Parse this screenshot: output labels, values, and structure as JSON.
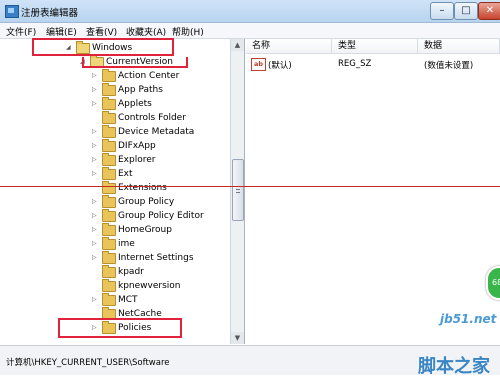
{
  "window": {
    "title": "注册表编辑器",
    "minimize": "–",
    "maximize": "□",
    "close": "✕"
  },
  "menu": [
    "文件(F)",
    "编辑(E)",
    "查看(V)",
    "收藏夹(A)",
    "帮助(H)"
  ],
  "tree": {
    "items": [
      {
        "label": "Windows",
        "expander": "◢"
      },
      {
        "label": "CurrentVersion",
        "expander": "◢"
      },
      {
        "label": "Action Center",
        "expander": "▷"
      },
      {
        "label": "App Paths",
        "expander": "▷"
      },
      {
        "label": "Applets",
        "expander": "▷"
      },
      {
        "label": "Controls Folder",
        "expander": ""
      },
      {
        "label": "Device Metadata",
        "expander": "▷"
      },
      {
        "label": "DIFxApp",
        "expander": "▷"
      },
      {
        "label": "Explorer",
        "expander": "▷"
      },
      {
        "label": "Ext",
        "expander": "▷"
      },
      {
        "label": "Extensions",
        "expander": ""
      },
      {
        "label": "Group Policy",
        "expander": "▷"
      },
      {
        "label": "Group Policy Editor",
        "expander": "▷"
      },
      {
        "label": "HomeGroup",
        "expander": "▷"
      },
      {
        "label": "ime",
        "expander": "▷"
      },
      {
        "label": "Internet Settings",
        "expander": "▷"
      },
      {
        "label": "kpadr",
        "expander": ""
      },
      {
        "label": "kpnewversion",
        "expander": ""
      },
      {
        "label": "MCT",
        "expander": "▷"
      },
      {
        "label": "NetCache",
        "expander": ""
      },
      {
        "label": "Policies",
        "expander": "▷"
      }
    ]
  },
  "values": {
    "columns": [
      "名称",
      "类型",
      "数据"
    ],
    "rows": [
      {
        "icon": "ab",
        "name": "(默认)",
        "type": "REG_SZ",
        "data": "(数值未设置)"
      }
    ]
  },
  "status": {
    "path": "计算机\\HKEY_CURRENT_USER\\Software"
  },
  "watermark": {
    "site": "jb51.net",
    "brand": "脚本之家",
    "badge": "68"
  },
  "colors": {
    "highlight": "#e0233a",
    "folder": "#e8c45a"
  }
}
